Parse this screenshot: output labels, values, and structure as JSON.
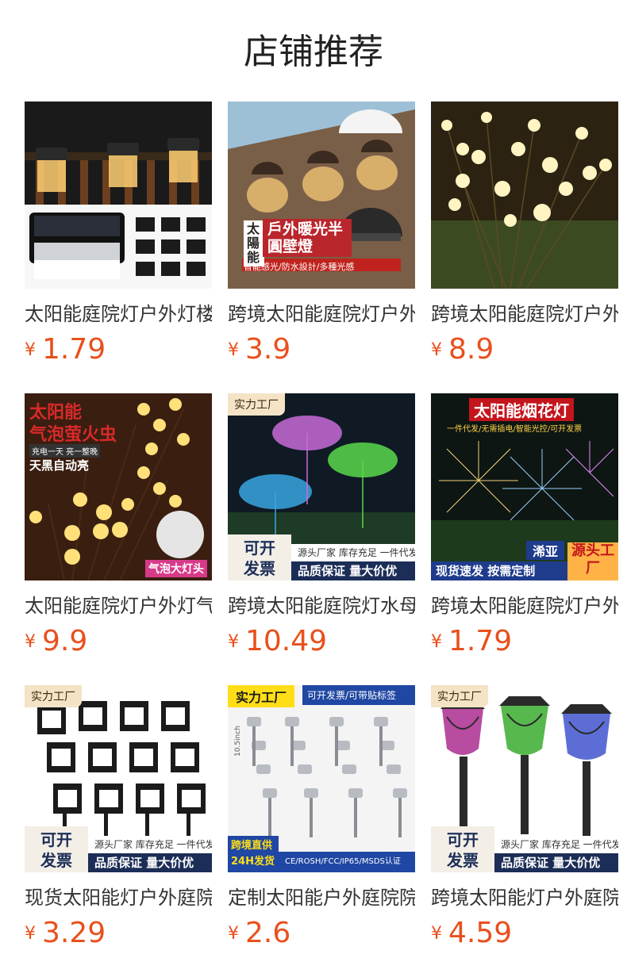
{
  "section_title": "店铺推荐",
  "currency": "¥",
  "products": [
    {
      "name": "太阳能庭院灯户外灯楼梯台阶灯",
      "price": "1.79",
      "image": "solar-step-lights"
    },
    {
      "name": "跨境太阳能庭院灯户外暖光半圆壁灯",
      "price": "3.9",
      "image": "half-round-wall-lights",
      "overlays": {
        "badge_left": "太陽能",
        "headline": "戶外暖光半圓壁燈",
        "caption": "智能感光/防水設計/多種光感"
      }
    },
    {
      "name": "跨境太阳能庭院灯户外萤火虫灯",
      "price": "8.9",
      "image": "firefly-garden-lights"
    },
    {
      "name": "太阳能庭院灯户外灯气泡萤火虫灯",
      "price": "9.9",
      "image": "bubble-firefly-lights",
      "overlays": {
        "headline_1": "太阳能",
        "headline_2": "气泡萤火虫",
        "small": "充电一天 亮一整晚",
        "sub": "天黑自动亮",
        "corner": "气泡大灯头"
      }
    },
    {
      "name": "跨境太阳能庭院灯水母灯户外草坪灯",
      "price": "10.49",
      "image": "jellyfish-lights",
      "overlays": {
        "factory": "实力工厂",
        "invoice_1": "可开",
        "invoice_2": "发票",
        "strip_top": "源头厂家 库存充足 一件代发",
        "strip_bottom": "品质保证 量大价优"
      }
    },
    {
      "name": "跨境太阳能庭院灯户外烟花灯",
      "price": "1.79",
      "image": "firework-lights",
      "overlays": {
        "headline": "太阳能烟花灯",
        "small": "一件代发/无需插电/智能光控/可开发票",
        "brand": "浠亚",
        "box": "源头工厂",
        "strip": "现货速发 按需定制"
      }
    },
    {
      "name": "现货太阳能灯户外庭院草坪灯",
      "price": "3.29",
      "image": "lantern-lawn-lights",
      "overlays": {
        "factory": "实力工厂",
        "invoice_1": "可开",
        "invoice_2": "发票",
        "strip_top": "源头厂家 库存充足 一件代发",
        "strip_bottom": "品质保证 量大价优"
      }
    },
    {
      "name": "定制太阳能户外庭院院子草坪灯",
      "price": "2.6",
      "image": "stainless-stake-lights",
      "overlays": {
        "factory": "实力工厂",
        "top_right": "可开发票/可带贴标签",
        "bottom_left_1": "跨境直供",
        "bottom_left_2": "24H发货",
        "bottom_right": "CE/ROSH/FCC/IP65/MSDS认证",
        "dimension": "10.5inch"
      }
    },
    {
      "name": "跨境太阳能灯户外庭院草坪灯",
      "price": "4.59",
      "image": "colored-glass-lights",
      "overlays": {
        "factory": "实力工厂",
        "invoice_1": "可开",
        "invoice_2": "发票",
        "strip_top": "源头厂家 库存充足 一件代发",
        "strip_bottom": "品质保证 量大价优"
      }
    }
  ]
}
